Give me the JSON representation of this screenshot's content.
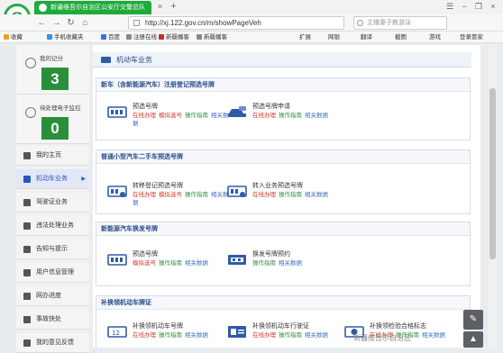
{
  "browser": {
    "tab_title": "新疆维吾尔自治区公安厅交警总队",
    "tab_close": "×",
    "new_tab": "+",
    "address": "http://xj.122.gov.cn/m/showPageVeh",
    "search_placeholder": "主播妻子教游泳",
    "nav": {
      "back": "←",
      "forward": "→",
      "refresh": "↻",
      "home": "⌂"
    },
    "controls": {
      "menu": "☰",
      "minimize": "−",
      "restore": "❐",
      "close": "×"
    },
    "bookmarks": [
      {
        "label": "收藏",
        "color": "#e6a42b"
      },
      {
        "label": "手机收藏夹",
        "color": "#3a8ee6"
      },
      {
        "label": "百度",
        "color": "#3a6fe6"
      },
      {
        "label": "注册在线",
        "color": "#888888"
      },
      {
        "label": "新疆播客",
        "color": "#cc2a2a"
      },
      {
        "label": "新疆播客",
        "color": "#888888"
      }
    ],
    "extensions": [
      "扩展",
      "网银",
      "翻译",
      "截图",
      "游戏",
      "登录管家"
    ]
  },
  "sidebar": {
    "stats": [
      {
        "label": "我的记分",
        "value": "3"
      },
      {
        "label": "待处理电子监控",
        "value": "0"
      }
    ],
    "menu": [
      {
        "label": "我的主页",
        "active": false
      },
      {
        "label": "机动车业务",
        "active": true
      },
      {
        "label": "驾驶证业务",
        "active": false
      },
      {
        "label": "违法处理业务",
        "active": false
      },
      {
        "label": "告知与提示",
        "active": false
      },
      {
        "label": "用户信息管理",
        "active": false
      },
      {
        "label": "网办进度",
        "active": false
      },
      {
        "label": "事故快处",
        "active": false
      },
      {
        "label": "我的意见反馈",
        "active": false
      }
    ],
    "active_caret": "▶"
  },
  "content": {
    "heading": "机动车业务",
    "sections": [
      {
        "title": "新车（含新能源汽车）注册登记预选号牌",
        "items": [
          {
            "name": "预选号牌",
            "links": [
              "在线办理",
              "模拟选号",
              "操作指南",
              "相关数据"
            ]
          },
          {
            "name": "预选号牌申请",
            "links": [
              "在线办理",
              "操作指南",
              "相关数据"
            ]
          }
        ]
      },
      {
        "title": "普通小型汽车二手车预选号牌",
        "items": [
          {
            "name": "转移登记预选号牌",
            "links": [
              "在线办理",
              "模拟选号",
              "操作指南",
              "相关数据"
            ]
          },
          {
            "name": "转入业务预选号牌",
            "links": [
              "在线办理",
              "操作指南",
              "相关数据"
            ]
          }
        ]
      },
      {
        "title": "新能源汽车换发号牌",
        "items": [
          {
            "name": "预选号牌",
            "links": [
              "模拟选号",
              "操作指南",
              "相关数据"
            ]
          },
          {
            "name": "换发号牌预约",
            "links": [
              "操作指南",
              "相关数据"
            ]
          }
        ]
      },
      {
        "title": "补换领机动车牌证",
        "items": [
          {
            "name": "补换领机动车号牌",
            "links": [
              "在线办理",
              "操作指南",
              "相关数据"
            ]
          },
          {
            "name": "补换领机动车行驶证",
            "links": [
              "在线办理",
              "操作指南",
              "相关数据"
            ]
          },
          {
            "name": "补换领检验合格标志",
            "links": [
              "在线办理",
              "操作指南",
              "相关数据"
            ]
          }
        ]
      }
    ]
  },
  "floating": {
    "edit": "✎",
    "top": "▲"
  },
  "watermark": "新疆维吾尔自治区"
}
